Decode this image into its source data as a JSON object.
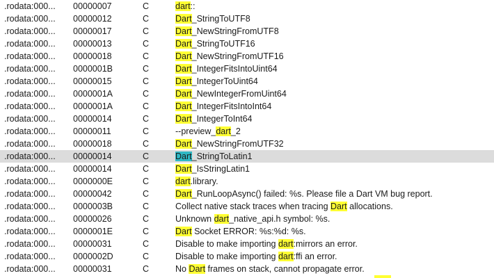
{
  "rows": [
    {
      "address": ".rodata:000...",
      "length": "00000007",
      "type": "C",
      "parts": [
        {
          "t": "dart",
          "h": true
        },
        {
          "t": "::",
          "h": false
        }
      ]
    },
    {
      "address": ".rodata:000...",
      "length": "00000012",
      "type": "C",
      "parts": [
        {
          "t": "Dart",
          "h": true
        },
        {
          "t": "_StringToUTF8",
          "h": false
        }
      ]
    },
    {
      "address": ".rodata:000...",
      "length": "00000017",
      "type": "C",
      "parts": [
        {
          "t": "Dart",
          "h": true
        },
        {
          "t": "_NewStringFromUTF8",
          "h": false
        }
      ]
    },
    {
      "address": ".rodata:000...",
      "length": "00000013",
      "type": "C",
      "parts": [
        {
          "t": "Dart",
          "h": true
        },
        {
          "t": "_StringToUTF16",
          "h": false
        }
      ]
    },
    {
      "address": ".rodata:000...",
      "length": "00000018",
      "type": "C",
      "parts": [
        {
          "t": "Dart",
          "h": true
        },
        {
          "t": "_NewStringFromUTF16",
          "h": false
        }
      ]
    },
    {
      "address": ".rodata:000...",
      "length": "0000001B",
      "type": "C",
      "parts": [
        {
          "t": "Dart",
          "h": true
        },
        {
          "t": "_IntegerFitsIntoUint64",
          "h": false
        }
      ]
    },
    {
      "address": ".rodata:000...",
      "length": "00000015",
      "type": "C",
      "parts": [
        {
          "t": "Dart",
          "h": true
        },
        {
          "t": "_IntegerToUint64",
          "h": false
        }
      ]
    },
    {
      "address": ".rodata:000...",
      "length": "0000001A",
      "type": "C",
      "parts": [
        {
          "t": "Dart",
          "h": true
        },
        {
          "t": "_NewIntegerFromUint64",
          "h": false
        }
      ]
    },
    {
      "address": ".rodata:000...",
      "length": "0000001A",
      "type": "C",
      "parts": [
        {
          "t": "Dart",
          "h": true
        },
        {
          "t": "_IntegerFitsIntoInt64",
          "h": false
        }
      ]
    },
    {
      "address": ".rodata:000...",
      "length": "00000014",
      "type": "C",
      "parts": [
        {
          "t": "Dart",
          "h": true
        },
        {
          "t": "_IntegerToInt64",
          "h": false
        }
      ]
    },
    {
      "address": ".rodata:000...",
      "length": "00000011",
      "type": "C",
      "parts": [
        {
          "t": "--preview_",
          "h": false
        },
        {
          "t": "dart",
          "h": true
        },
        {
          "t": "_2",
          "h": false
        }
      ]
    },
    {
      "address": ".rodata:000...",
      "length": "00000018",
      "type": "C",
      "parts": [
        {
          "t": "Dart",
          "h": true
        },
        {
          "t": "_NewStringFromUTF32",
          "h": false
        }
      ]
    },
    {
      "address": ".rodata:000...",
      "length": "00000014",
      "type": "C",
      "selected": true,
      "parts": [
        {
          "t": "Dart",
          "h": true,
          "cur": true
        },
        {
          "t": "_StringToLatin1",
          "h": false
        }
      ]
    },
    {
      "address": ".rodata:000...",
      "length": "00000014",
      "type": "C",
      "parts": [
        {
          "t": "Dart",
          "h": true
        },
        {
          "t": "_IsStringLatin1",
          "h": false
        }
      ]
    },
    {
      "address": ".rodata:000...",
      "length": "0000000E",
      "type": "C",
      "parts": [
        {
          "t": "dart",
          "h": true
        },
        {
          "t": ".library.",
          "h": false
        }
      ]
    },
    {
      "address": ".rodata:000...",
      "length": "00000042",
      "type": "C",
      "parts": [
        {
          "t": "Dart",
          "h": true
        },
        {
          "t": "_RunLoopAsync() failed: %s. Please file a Dart VM bug report.",
          "h": false
        }
      ]
    },
    {
      "address": ".rodata:000...",
      "length": "0000003B",
      "type": "C",
      "parts": [
        {
          "t": "Collect native stack traces when tracing ",
          "h": false
        },
        {
          "t": "Dart",
          "h": true
        },
        {
          "t": " allocations.",
          "h": false
        }
      ]
    },
    {
      "address": ".rodata:000...",
      "length": "00000026",
      "type": "C",
      "parts": [
        {
          "t": "Unknown ",
          "h": false
        },
        {
          "t": "dart",
          "h": true
        },
        {
          "t": "_native_api.h symbol: %s.",
          "h": false
        }
      ]
    },
    {
      "address": ".rodata:000...",
      "length": "0000001E",
      "type": "C",
      "parts": [
        {
          "t": "Dart",
          "h": true
        },
        {
          "t": " Socket ERROR: %s:%d: %s.",
          "h": false
        }
      ]
    },
    {
      "address": ".rodata:000...",
      "length": "00000031",
      "type": "C",
      "parts": [
        {
          "t": "Disable to make importing ",
          "h": false
        },
        {
          "t": "dart",
          "h": true
        },
        {
          "t": ":mirrors an error.",
          "h": false
        }
      ]
    },
    {
      "address": ".rodata:000...",
      "length": "0000002D",
      "type": "C",
      "parts": [
        {
          "t": "Disable to make importing ",
          "h": false
        },
        {
          "t": "dart",
          "h": true
        },
        {
          "t": ":ffi an error.",
          "h": false
        }
      ]
    },
    {
      "address": ".rodata:000...",
      "length": "00000031",
      "type": "C",
      "parts": [
        {
          "t": "No ",
          "h": false
        },
        {
          "t": "Dart",
          "h": true
        },
        {
          "t": " frames on stack, cannot propagate error.",
          "h": false
        }
      ]
    }
  ],
  "colors": {
    "match_highlight": "#ffff33",
    "current_match": "#2fb8c4",
    "selected_row": "#dcdcdc"
  }
}
